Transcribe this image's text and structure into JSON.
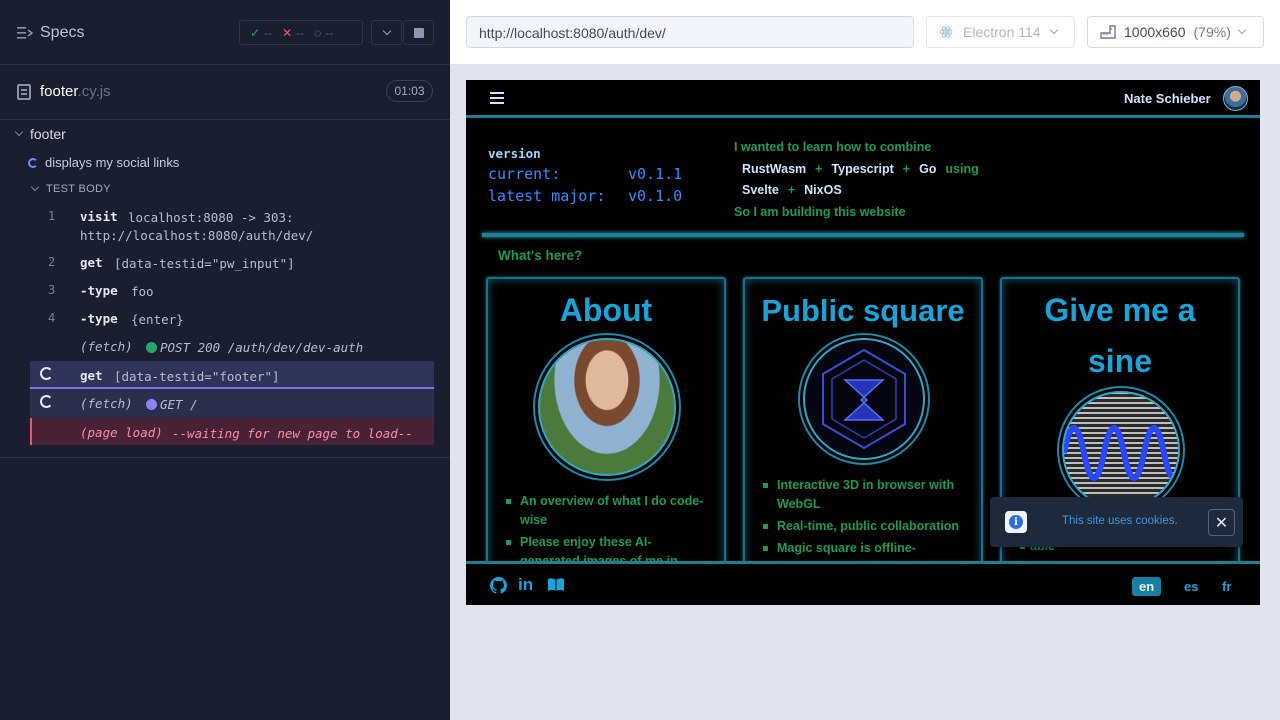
{
  "reporter": {
    "specs_label": "Specs",
    "stats": {
      "passed": "--",
      "failed": "--",
      "pending": "--"
    },
    "file": {
      "name": "footer",
      "ext": ".cy.js",
      "duration": "01:03"
    },
    "suite": "footer",
    "test": "displays my social links",
    "test_body_label": "TEST BODY",
    "commands": [
      {
        "num": "1",
        "name": "visit",
        "msg": "localhost:8080 -> 303:",
        "msg2": "http://localhost:8080/auth/dev/"
      },
      {
        "num": "2",
        "name": "get",
        "msg": "[data-testid=\"pw_input\"]"
      },
      {
        "num": "3",
        "name": "-type",
        "msg": "foo"
      },
      {
        "num": "4",
        "name": "-type",
        "msg": "{enter}"
      },
      {
        "name": "(fetch)",
        "msg": "POST 200 /auth/dev/dev-auth"
      },
      {
        "name": "get",
        "msg": "[data-testid=\"footer\"]"
      },
      {
        "name": "(fetch)",
        "msg": "GET /"
      },
      {
        "name": "(page load)",
        "msg": "--waiting for new page to load--"
      }
    ]
  },
  "runner": {
    "url": "http://localhost:8080/auth/dev/",
    "browser": "Electron 114",
    "viewport": "1000x660",
    "viewport_pct": "(79%)"
  },
  "app": {
    "user_name": "Nate Schieber",
    "version": {
      "title": "version",
      "current_label": "current:",
      "current": "v0.1.1",
      "latest_label": "latest major:",
      "latest": "v0.1.0"
    },
    "intro": {
      "line1": "I wanted to learn how to combine",
      "tech1": "RustWasm",
      "tech2": "Typescript",
      "tech3": "Go",
      "using": "using",
      "tech4": "Svelte",
      "tech5": "NixOS",
      "line3": "So I am building this website",
      "plus": "+"
    },
    "whats_here": "What's here?",
    "cards": [
      {
        "title": "About",
        "bullets": [
          "An overview of what I do code-wise",
          "Please enjoy these AI-generated images of me in"
        ]
      },
      {
        "title": "Public square",
        "bullets": [
          "Interactive 3D in browser with WebGL",
          "Real-time, public collaboration",
          "Magic square is offline-"
        ]
      },
      {
        "title_line1": "Give me a",
        "title_line2": "sine",
        "bullets": [
          "able"
        ]
      }
    ],
    "langs": [
      "en",
      "es",
      "fr"
    ],
    "toast": "This site uses cookies.",
    "icons": [
      "github-icon",
      "linkedin-icon",
      "blog-icon"
    ]
  }
}
